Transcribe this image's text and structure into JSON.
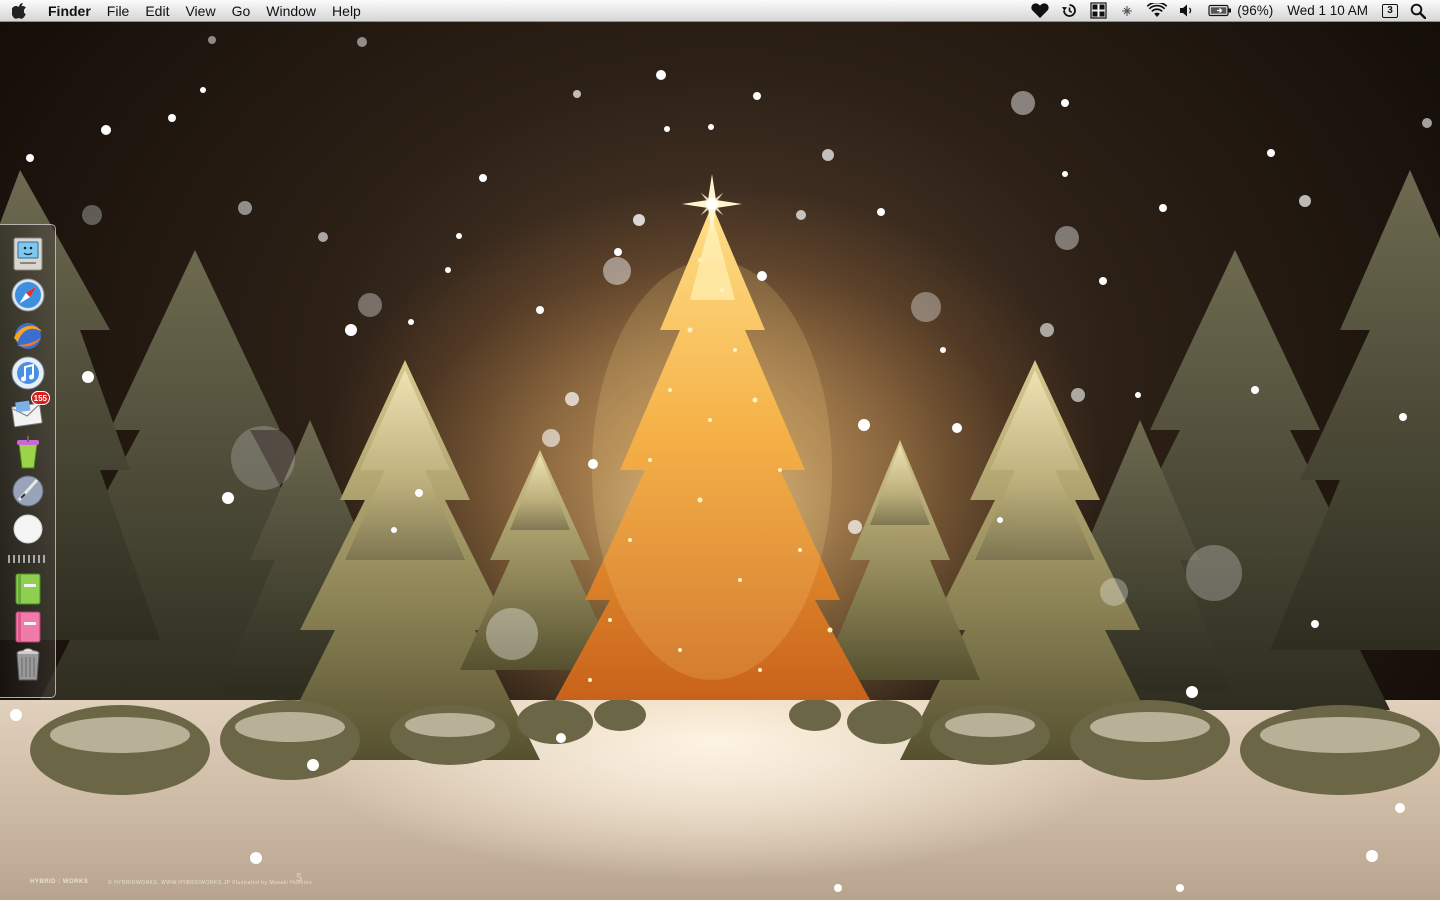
{
  "menubar": {
    "apple_icon": "apple-icon",
    "app_name": "Finder",
    "menus": [
      "File",
      "Edit",
      "View",
      "Go",
      "Window",
      "Help"
    ],
    "status": {
      "icons": [
        "heart-icon",
        "time-machine-icon",
        "spaces-icon",
        "bluetooth-icon",
        "wifi-icon",
        "volume-icon",
        "battery-icon"
      ],
      "battery_percent": "(96%)",
      "clock": "Wed 1 10 AM",
      "spaces_number": "3",
      "spotlight_icon": "spotlight-icon"
    }
  },
  "dock": {
    "items": [
      {
        "name": "finder",
        "icon": "finder-icon"
      },
      {
        "name": "safari",
        "icon": "safari-icon"
      },
      {
        "name": "browser",
        "icon": "browser-icon"
      },
      {
        "name": "itunes",
        "icon": "itunes-icon"
      },
      {
        "name": "mail",
        "icon": "mail-icon",
        "badge": "155"
      },
      {
        "name": "adium",
        "icon": "adium-icon"
      },
      {
        "name": "script-editor",
        "icon": "script-editor-icon"
      },
      {
        "name": "white-ball",
        "icon": "white-ball-icon"
      },
      {
        "name": "green-folder",
        "icon": "green-notebook-icon"
      },
      {
        "name": "pink-folder",
        "icon": "pink-notebook-icon"
      },
      {
        "name": "trash",
        "icon": "trash-icon"
      }
    ]
  },
  "wallpaper": {
    "description_hidden": true,
    "watermark_left": "HYBRID : WORKS",
    "watermark_credits": "© HYBRIDWORKS.  WWW.HYBRIDWORKS.JP  Illustrated by Masaki Hoshino",
    "watermark_anniversary": "5",
    "accent": "#f0b24a",
    "snow": "#ffffff"
  }
}
